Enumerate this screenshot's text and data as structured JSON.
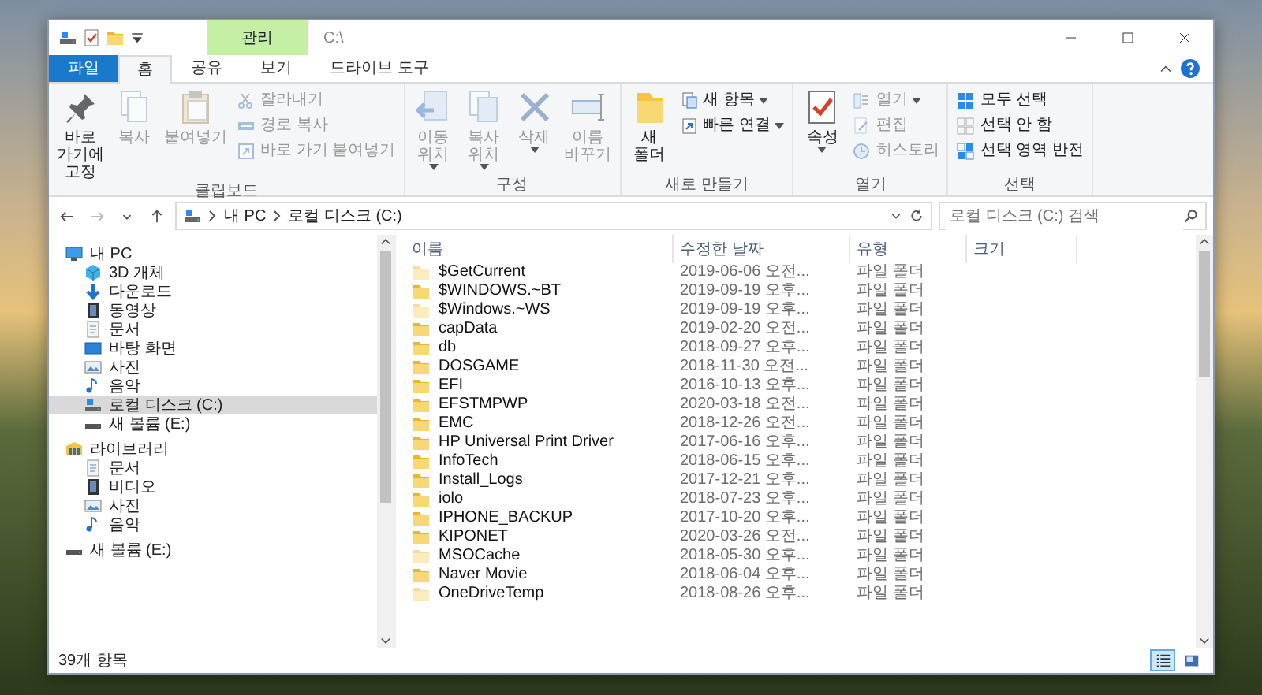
{
  "title_bar": {
    "context_label": "관리",
    "title": "C:\\"
  },
  "tabs": [
    {
      "label": "파일",
      "kind": "file",
      "selected": false
    },
    {
      "label": "홈",
      "kind": "normal",
      "selected": true
    },
    {
      "label": "공유",
      "kind": "normal",
      "selected": false
    },
    {
      "label": "보기",
      "kind": "normal",
      "selected": false
    },
    {
      "label": "드라이브 도구",
      "kind": "context",
      "selected": false
    }
  ],
  "ribbon": [
    {
      "label": "클립보드",
      "large": [
        {
          "kind": "pin",
          "label": "바로 가기에 고정",
          "disabled": false,
          "dropdown": false
        },
        {
          "kind": "copy",
          "label": "복사",
          "disabled": true,
          "dropdown": false
        },
        {
          "kind": "paste",
          "label": "붙여넣기",
          "disabled": true,
          "dropdown": false
        }
      ],
      "small": [
        {
          "kind": "cut",
          "label": "잘라내기",
          "disabled": true,
          "dropdown": false
        },
        {
          "kind": "copy-path",
          "label": "경로 복사",
          "disabled": true,
          "dropdown": false
        },
        {
          "kind": "paste-shortcut",
          "label": "바로 가기 붙여넣기",
          "disabled": true,
          "dropdown": false
        }
      ]
    },
    {
      "label": "구성",
      "large": [
        {
          "kind": "move",
          "label": "이동 위치",
          "disabled": true,
          "dropdown": true
        },
        {
          "kind": "copy-to",
          "label": "복사 위치",
          "disabled": true,
          "dropdown": true
        },
        {
          "kind": "delete",
          "label": "삭제",
          "disabled": true,
          "dropdown": true
        },
        {
          "kind": "rename",
          "label": "이름 바꾸기",
          "disabled": true,
          "dropdown": false
        }
      ]
    },
    {
      "label": "새로 만들기",
      "large": [
        {
          "kind": "new-folder",
          "label": "새 폴더",
          "disabled": false,
          "dropdown": false
        }
      ],
      "small": [
        {
          "kind": "new-item",
          "label": "새 항목",
          "disabled": false,
          "dropdown": true
        },
        {
          "kind": "easy-access",
          "label": "빠른 연결",
          "disabled": false,
          "dropdown": true
        }
      ]
    },
    {
      "label": "열기",
      "large": [
        {
          "kind": "properties",
          "label": "속성",
          "disabled": false,
          "dropdown": true
        }
      ],
      "small": [
        {
          "kind": "open",
          "label": "열기",
          "disabled": true,
          "dropdown": true
        },
        {
          "kind": "edit",
          "label": "편집",
          "disabled": true,
          "dropdown": false
        },
        {
          "kind": "history",
          "label": "히스토리",
          "disabled": true,
          "dropdown": false
        }
      ]
    },
    {
      "label": "선택",
      "small": [
        {
          "kind": "select-all",
          "label": "모두 선택",
          "disabled": false,
          "dropdown": false
        },
        {
          "kind": "select-none",
          "label": "선택 안 함",
          "disabled": false,
          "dropdown": false
        },
        {
          "kind": "invert",
          "label": "선택 영역 반전",
          "disabled": false,
          "dropdown": false
        }
      ]
    }
  ],
  "address": {
    "path": [
      "내 PC",
      "로컬 디스크 (C:)"
    ],
    "search_placeholder": "로컬 디스크 (C:) 검색"
  },
  "nav": [
    {
      "label": "내 PC",
      "kind": "pc",
      "selected": false,
      "children": [
        {
          "label": "3D 개체",
          "kind": "objects",
          "selected": false
        },
        {
          "label": "다운로드",
          "kind": "download",
          "selected": false
        },
        {
          "label": "동영상",
          "kind": "video",
          "selected": false
        },
        {
          "label": "문서",
          "kind": "document",
          "selected": false
        },
        {
          "label": "바탕 화면",
          "kind": "desktop",
          "selected": false
        },
        {
          "label": "사진",
          "kind": "picture",
          "selected": false
        },
        {
          "label": "음악",
          "kind": "music",
          "selected": false
        },
        {
          "label": "로컬 디스크 (C:)",
          "kind": "system-drive",
          "selected": true
        },
        {
          "label": "새 볼륨 (E:)",
          "kind": "drive",
          "selected": false
        }
      ]
    },
    {
      "label": "라이브러리",
      "kind": "library",
      "selected": false,
      "children": [
        {
          "label": "문서",
          "kind": "document",
          "selected": false
        },
        {
          "label": "비디오",
          "kind": "video",
          "selected": false
        },
        {
          "label": "사진",
          "kind": "picture",
          "selected": false
        },
        {
          "label": "음악",
          "kind": "music",
          "selected": false
        }
      ]
    },
    {
      "label": "새 볼륨 (E:)",
      "kind": "drive",
      "selected": false
    }
  ],
  "columns": [
    "이름",
    "수정한 날짜",
    "유형",
    "크기"
  ],
  "rows": [
    {
      "name": "$GetCurrent",
      "date": "2019-06-06 오전...",
      "type": "파일 폴더",
      "hidden": true
    },
    {
      "name": "$WINDOWS.~BT",
      "date": "2019-09-19 오후...",
      "type": "파일 폴더",
      "hidden": false
    },
    {
      "name": "$Windows.~WS",
      "date": "2019-09-19 오후...",
      "type": "파일 폴더",
      "hidden": true
    },
    {
      "name": "capData",
      "date": "2019-02-20 오전...",
      "type": "파일 폴더",
      "hidden": false
    },
    {
      "name": "db",
      "date": "2018-09-27 오후...",
      "type": "파일 폴더",
      "hidden": false
    },
    {
      "name": "DOSGAME",
      "date": "2018-11-30 오전...",
      "type": "파일 폴더",
      "hidden": false
    },
    {
      "name": "EFI",
      "date": "2016-10-13 오후...",
      "type": "파일 폴더",
      "hidden": false
    },
    {
      "name": "EFSTMPWP",
      "date": "2020-03-18 오전...",
      "type": "파일 폴더",
      "hidden": false
    },
    {
      "name": "EMC",
      "date": "2018-12-26 오전...",
      "type": "파일 폴더",
      "hidden": false
    },
    {
      "name": "HP Universal Print Driver",
      "date": "2017-06-16 오후...",
      "type": "파일 폴더",
      "hidden": false
    },
    {
      "name": "InfoTech",
      "date": "2018-06-15 오후...",
      "type": "파일 폴더",
      "hidden": false
    },
    {
      "name": "Install_Logs",
      "date": "2017-12-21 오후...",
      "type": "파일 폴더",
      "hidden": false
    },
    {
      "name": "iolo",
      "date": "2018-07-23 오후...",
      "type": "파일 폴더",
      "hidden": false
    },
    {
      "name": "IPHONE_BACKUP",
      "date": "2017-10-20 오후...",
      "type": "파일 폴더",
      "hidden": false
    },
    {
      "name": "KIPONET",
      "date": "2020-03-26 오전...",
      "type": "파일 폴더",
      "hidden": false
    },
    {
      "name": "MSOCache",
      "date": "2018-05-30 오후...",
      "type": "파일 폴더",
      "hidden": true
    },
    {
      "name": "Naver Movie",
      "date": "2018-06-04 오후...",
      "type": "파일 폴더",
      "hidden": false
    },
    {
      "name": "OneDriveTemp",
      "date": "2018-08-26 오후...",
      "type": "파일 폴더",
      "hidden": true
    }
  ],
  "status_bar": {
    "count": "39개 항목",
    "views": [
      {
        "kind": "details",
        "selected": true
      },
      {
        "kind": "large-icons",
        "selected": false
      }
    ]
  }
}
